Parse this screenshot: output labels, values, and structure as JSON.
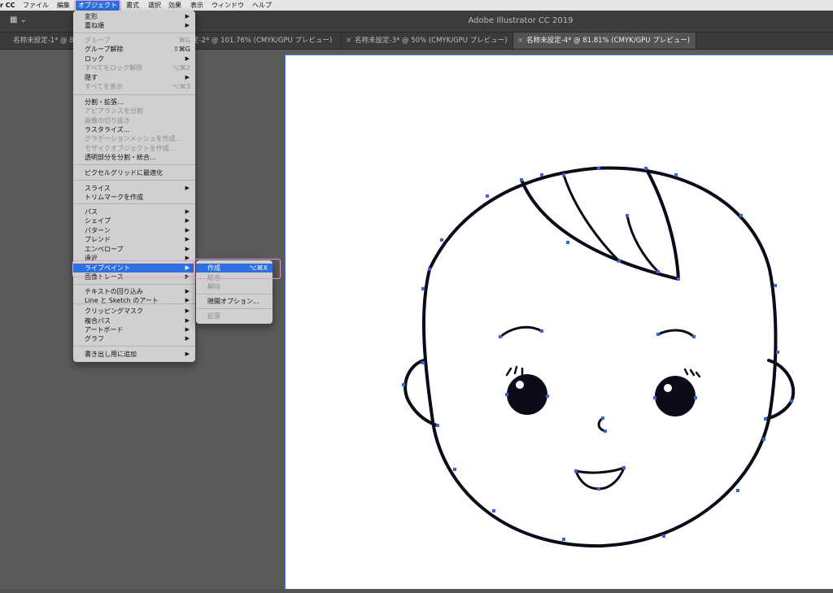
{
  "menubar": {
    "items": [
      "r CC",
      "ファイル",
      "編集",
      "オブジェクト",
      "書式",
      "選択",
      "効果",
      "表示",
      "ウィンドウ",
      "ヘルプ"
    ]
  },
  "app": {
    "title": "Adobe Illustrator CC 2019"
  },
  "tabs": [
    "名称未設定-1* @ 80% (C",
    "定-2* @ 101.76% (CMYK/GPU プレビュー)",
    "名称未設定-3* @ 50% (CMYK/GPU プレビュー)",
    "名称未設定-4* @ 81.81% (CMYK/GPU プレビュー)"
  ],
  "tab_close": "×",
  "object_menu": [
    {
      "label": "変形",
      "arrow": "▶"
    },
    {
      "label": "重ね順",
      "arrow": "▶"
    },
    {
      "label": "グループ",
      "shortcut": "⌘G",
      "disabled": true
    },
    {
      "label": "グループ解除",
      "shortcut": "⇧⌘G"
    },
    {
      "label": "ロック",
      "arrow": "▶"
    },
    {
      "label": "すべてをロック解除",
      "shortcut": "⌥⌘2",
      "disabled": true
    },
    {
      "label": "隠す",
      "arrow": "▶"
    },
    {
      "label": "すべてを表示",
      "shortcut": "⌥⌘3",
      "disabled": true
    },
    {
      "label": "分割・拡張..."
    },
    {
      "label": "アピアランスを分割",
      "disabled": true
    },
    {
      "label": "画像の切り抜き",
      "disabled": true
    },
    {
      "label": "ラスタライズ..."
    },
    {
      "label": "グラデーションメッシュを作成...",
      "disabled": true
    },
    {
      "label": "モザイクオブジェクトを作成...",
      "disabled": true
    },
    {
      "label": "透明部分を分割・統合..."
    },
    {
      "label": "ピクセルグリッドに最適化"
    },
    {
      "label": "スライス",
      "arrow": "▶"
    },
    {
      "label": "トリムマークを作成"
    },
    {
      "label": "パス",
      "arrow": "▶"
    },
    {
      "label": "シェイプ",
      "arrow": "▶"
    },
    {
      "label": "パターン",
      "arrow": "▶"
    },
    {
      "label": "ブレンド",
      "arrow": "▶"
    },
    {
      "label": "エンベロープ",
      "arrow": "▶"
    },
    {
      "label": "遠近",
      "arrow": "▶"
    },
    {
      "label": "ライブペイント",
      "arrow": "▶",
      "selected": true
    },
    {
      "label": "画像トレース",
      "arrow": "▶"
    },
    {
      "label": "テキストの回り込み",
      "arrow": "▶"
    },
    {
      "label": "Line と Sketch のアート",
      "arrow": "▶"
    },
    {
      "label": "クリッピングマスク",
      "arrow": "▶"
    },
    {
      "label": "複合パス",
      "arrow": "▶"
    },
    {
      "label": "アートボード",
      "arrow": "▶"
    },
    {
      "label": "グラフ",
      "arrow": "▶"
    },
    {
      "label": "書き出し用に追加",
      "arrow": "▶"
    }
  ],
  "livepaint_submenu": [
    {
      "label": "作成",
      "shortcut": "⌥⌘X",
      "selected": true
    },
    {
      "label": "結合",
      "disabled": true
    },
    {
      "label": "解除",
      "disabled": true
    },
    {
      "label": "隙間オプション..."
    },
    {
      "label": "拡張",
      "disabled": true
    }
  ],
  "colors": {
    "accent": "#2f6fe0",
    "highlight_outline": "#e59ac7",
    "anchor": "#3d63d6",
    "stroke": "#0b0b1a"
  }
}
